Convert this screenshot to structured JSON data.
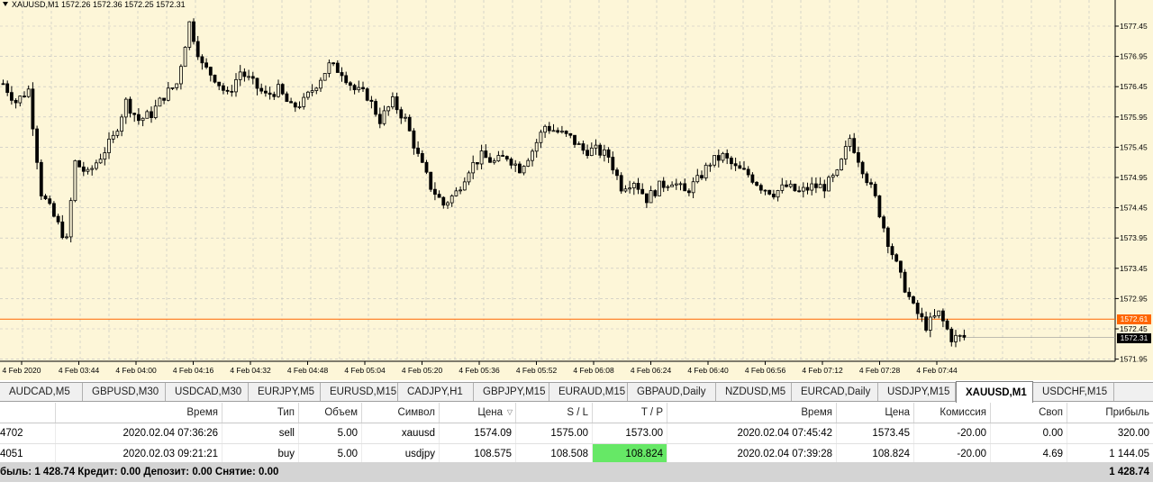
{
  "chart": {
    "header": "XAUUSD,M1  1572.26 1572.36 1572.25 1572.31",
    "price_ticks": [
      "1577.45",
      "1576.95",
      "1576.45",
      "1575.95",
      "1575.45",
      "1574.95",
      "1574.45",
      "1573.95",
      "1573.45",
      "1572.95",
      "1572.45",
      "1571.95"
    ],
    "time_ticks": [
      "4 Feb 2020",
      "4 Feb 03:44",
      "4 Feb 04:00",
      "4 Feb 04:16",
      "4 Feb 04:32",
      "4 Feb 04:48",
      "4 Feb 05:04",
      "4 Feb 05:20",
      "4 Feb 05:36",
      "4 Feb 05:52",
      "4 Feb 06:08",
      "4 Feb 06:24",
      "4 Feb 06:40",
      "4 Feb 06:56",
      "4 Feb 07:12",
      "4 Feb 07:28",
      "4 Feb 07:44"
    ],
    "line_price_label": "1572.61",
    "bid_price_label": "1572.31",
    "line_color": "#ff6600",
    "background_color": "#fdf6d8",
    "grid_color": "#c0c0c0"
  },
  "chart_data": {
    "type": "candlestick",
    "symbol": "XAUUSD",
    "timeframe": "M1",
    "ylim": [
      1571.9,
      1577.7
    ],
    "price_ticks": [
      1577.45,
      1576.95,
      1576.45,
      1575.95,
      1575.45,
      1574.95,
      1574.45,
      1573.95,
      1573.45,
      1572.95,
      1572.45,
      1571.95
    ],
    "horizontal_line": 1572.61,
    "last_price": 1572.31,
    "ohlc": {
      "open": 1572.26,
      "high": 1572.36,
      "low": 1572.25,
      "close": 1572.31
    },
    "close_path": [
      [
        0,
        1576.5
      ],
      [
        3,
        1576.2
      ],
      [
        6,
        1576.4
      ],
      [
        9,
        1574.7
      ],
      [
        12,
        1574.3
      ],
      [
        15,
        1573.9
      ],
      [
        17,
        1575.2
      ],
      [
        20,
        1575.0
      ],
      [
        23,
        1575.3
      ],
      [
        26,
        1575.6
      ],
      [
        29,
        1576.2
      ],
      [
        32,
        1575.9
      ],
      [
        35,
        1576.0
      ],
      [
        38,
        1576.3
      ],
      [
        41,
        1576.5
      ],
      [
        44,
        1577.5
      ],
      [
        47,
        1576.8
      ],
      [
        50,
        1576.6
      ],
      [
        53,
        1576.3
      ],
      [
        56,
        1576.7
      ],
      [
        59,
        1576.5
      ],
      [
        62,
        1576.3
      ],
      [
        65,
        1576.4
      ],
      [
        68,
        1576.1
      ],
      [
        71,
        1576.2
      ],
      [
        74,
        1576.5
      ],
      [
        77,
        1576.8
      ],
      [
        80,
        1576.7
      ],
      [
        83,
        1576.4
      ],
      [
        86,
        1576.3
      ],
      [
        89,
        1575.9
      ],
      [
        92,
        1576.2
      ],
      [
        95,
        1575.9
      ],
      [
        98,
        1575.3
      ],
      [
        101,
        1574.8
      ],
      [
        104,
        1574.5
      ],
      [
        107,
        1574.7
      ],
      [
        110,
        1575.1
      ],
      [
        113,
        1575.3
      ],
      [
        116,
        1575.2
      ],
      [
        119,
        1575.3
      ],
      [
        122,
        1575.1
      ],
      [
        125,
        1575.4
      ],
      [
        128,
        1575.8
      ],
      [
        131,
        1575.7
      ],
      [
        134,
        1575.6
      ],
      [
        137,
        1575.4
      ],
      [
        140,
        1575.4
      ],
      [
        143,
        1575.3
      ],
      [
        146,
        1574.8
      ],
      [
        149,
        1574.9
      ],
      [
        152,
        1574.6
      ],
      [
        155,
        1574.8
      ],
      [
        158,
        1574.9
      ],
      [
        161,
        1574.7
      ],
      [
        164,
        1574.9
      ],
      [
        167,
        1575.2
      ],
      [
        170,
        1575.3
      ],
      [
        173,
        1575.1
      ],
      [
        176,
        1575.0
      ],
      [
        179,
        1574.8
      ],
      [
        182,
        1574.7
      ],
      [
        185,
        1574.8
      ],
      [
        188,
        1574.7
      ],
      [
        191,
        1574.8
      ],
      [
        194,
        1574.8
      ],
      [
        197,
        1575.0
      ],
      [
        200,
        1575.6
      ],
      [
        203,
        1575.1
      ],
      [
        206,
        1574.6
      ],
      [
        209,
        1573.9
      ],
      [
        212,
        1573.3
      ],
      [
        215,
        1572.8
      ],
      [
        218,
        1572.5
      ],
      [
        221,
        1572.7
      ],
      [
        224,
        1572.3
      ],
      [
        227,
        1572.31
      ]
    ]
  },
  "tabs": [
    "AUDCAD,M5",
    "GBPUSD,M30",
    "USDCAD,M30",
    "EURJPY,M5",
    "EURUSD,M15",
    "CADJPY,H1",
    "GBPJPY,M15",
    "EURAUD,M15",
    "GBPAUD,Daily",
    "NZDUSD,M5",
    "EURCAD,Daily",
    "USDJPY,M15",
    "XAUUSD,M1",
    "USDCHF,M15"
  ],
  "active_tab": "XAUUSD,M1",
  "table": {
    "headers": [
      "",
      "Время",
      "Тип",
      "Объем",
      "Символ",
      "Цена",
      "S / L",
      "T / P",
      "Время",
      "Цена",
      "Комиссия",
      "Своп",
      "Прибыль"
    ],
    "rows": [
      [
        "4702",
        "2020.02.04 07:36:26",
        "sell",
        "5.00",
        "xauusd",
        "1574.09",
        "1575.00",
        "1573.00",
        "2020.02.04 07:45:42",
        "1573.45",
        "-20.00",
        "0.00",
        "320.00"
      ],
      [
        "4051",
        "2020.02.03 09:21:21",
        "buy",
        "5.00",
        "usdjpy",
        "108.575",
        "108.508",
        "108.824",
        "2020.02.04 07:39:28",
        "108.824",
        "-20.00",
        "4.69",
        "1 144.05"
      ]
    ],
    "tp_hit_color": "#66e866"
  },
  "summary": {
    "left": "быль: 1 428.74  Кредит: 0.00  Депозит: 0.00  Снятие: 0.00",
    "total": "1 428.74"
  }
}
